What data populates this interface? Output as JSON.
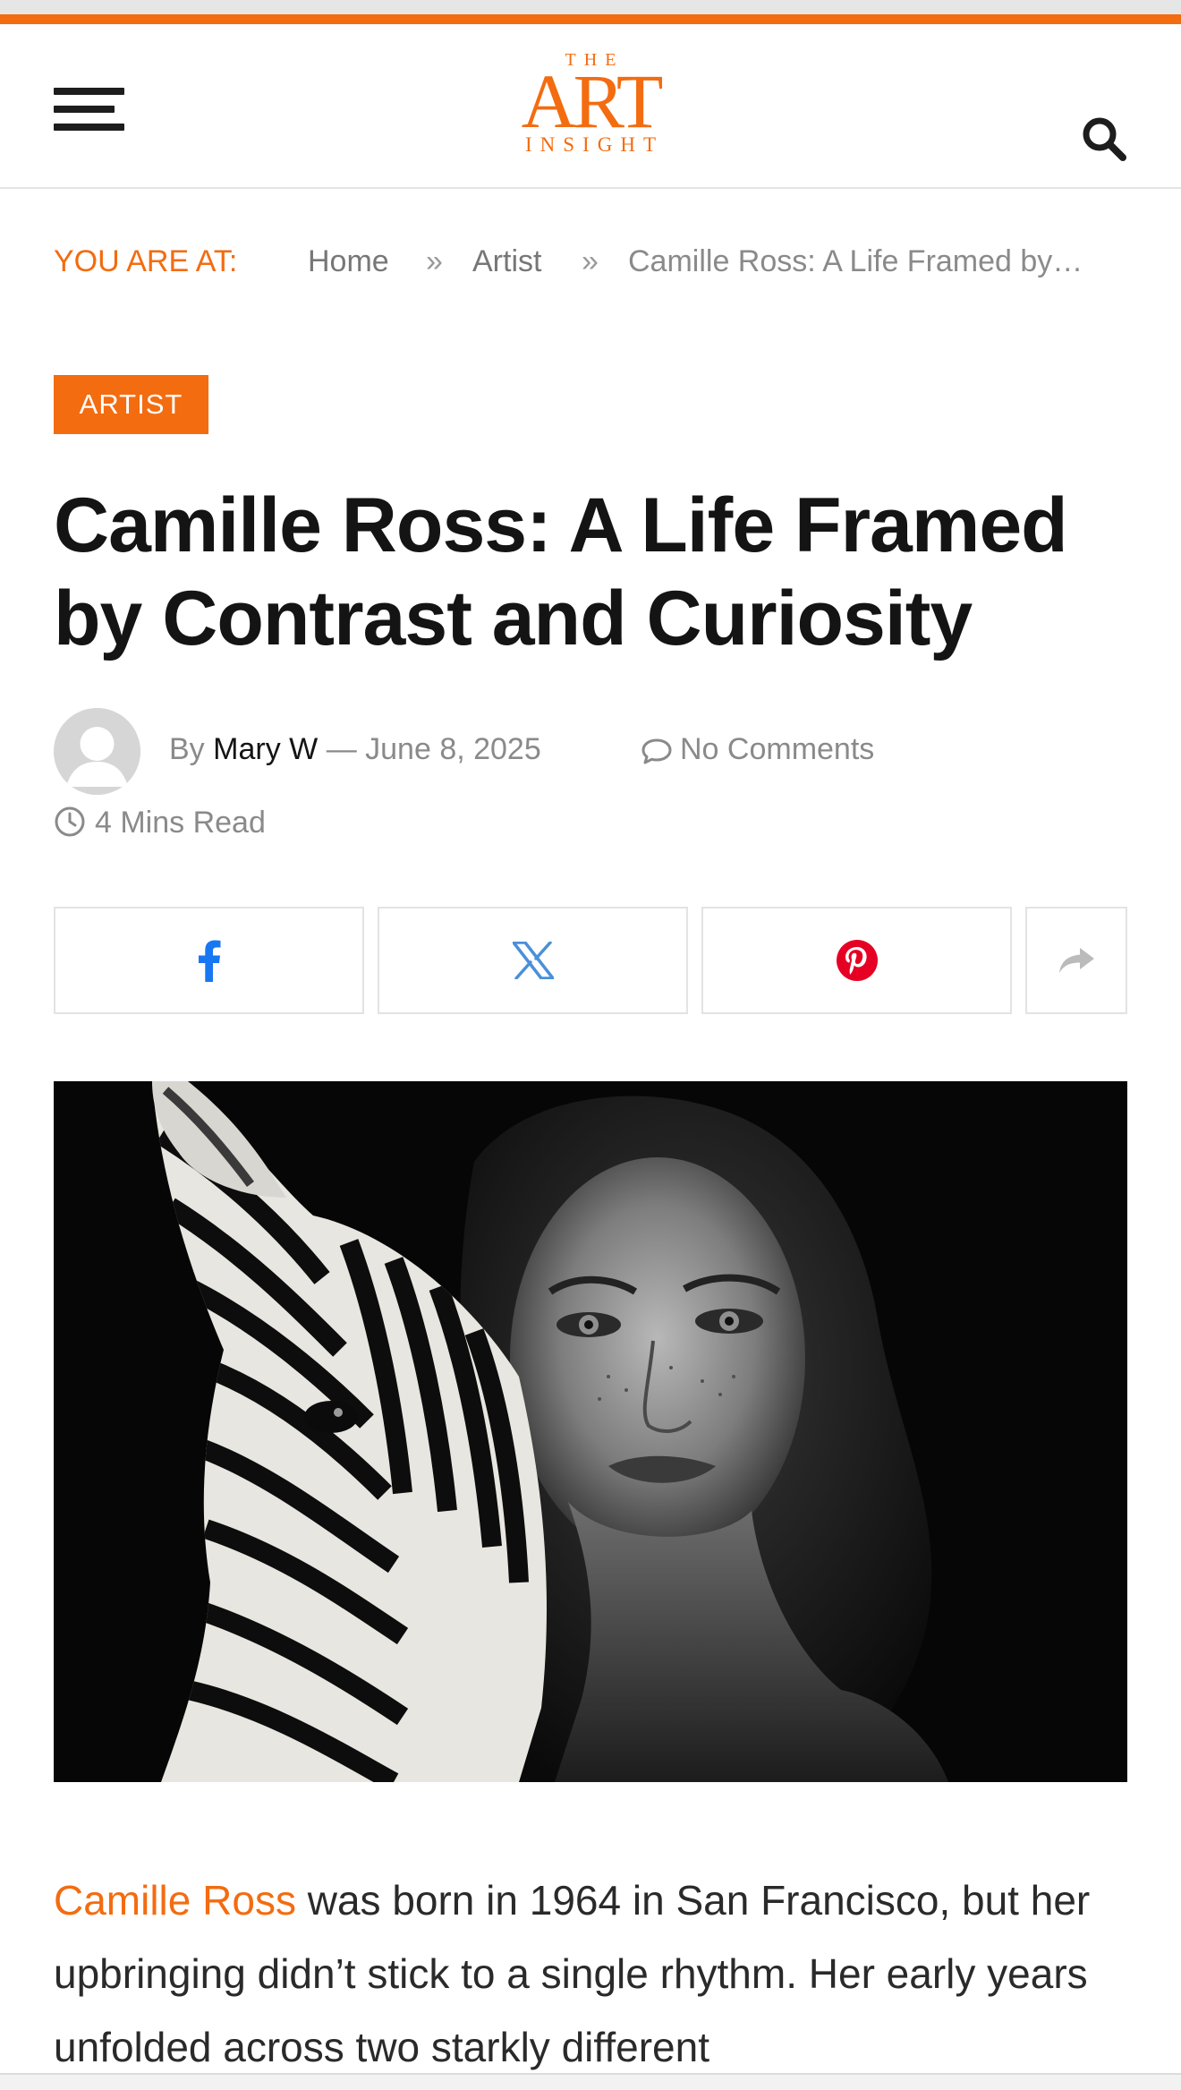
{
  "colors": {
    "accent": "#f36c10",
    "facebook": "#1877f2",
    "twitter": "#4a90d9",
    "pinterest": "#e60023",
    "share": "#bbbbbb"
  },
  "header": {
    "logo": {
      "line1": "THE",
      "line2": "ART",
      "line3": "INSIGHT"
    },
    "menu_icon": "hamburger-menu-icon",
    "search_icon": "search-icon"
  },
  "breadcrumb": {
    "lead": "YOU ARE AT:",
    "items": [
      "Home",
      "Artist"
    ],
    "separator": "»",
    "current": "Camille Ross: A Life Framed by…"
  },
  "post": {
    "category": "ARTIST",
    "title": "Camille Ross: A Life Framed by Contrast and Curiosity",
    "by_label": "By",
    "author": "Mary W",
    "dash": "—",
    "date": "June 8, 2025",
    "comments": "No Comments",
    "read_time": "4 Mins Read"
  },
  "share_buttons": [
    {
      "network": "facebook",
      "icon": "facebook-icon"
    },
    {
      "network": "x",
      "icon": "x-twitter-icon"
    },
    {
      "network": "pinterest",
      "icon": "pinterest-icon"
    },
    {
      "network": "more",
      "icon": "share-arrow-icon"
    }
  ],
  "hero_image": {
    "subject": "Black and white portrait of a woman beside a zebra"
  },
  "article": {
    "lead_link": "Camille Ross",
    "text": " was born in 1964 in San Francisco, but her upbringing didn’t stick to a single rhythm. Her early years unfolded across two starkly different"
  }
}
